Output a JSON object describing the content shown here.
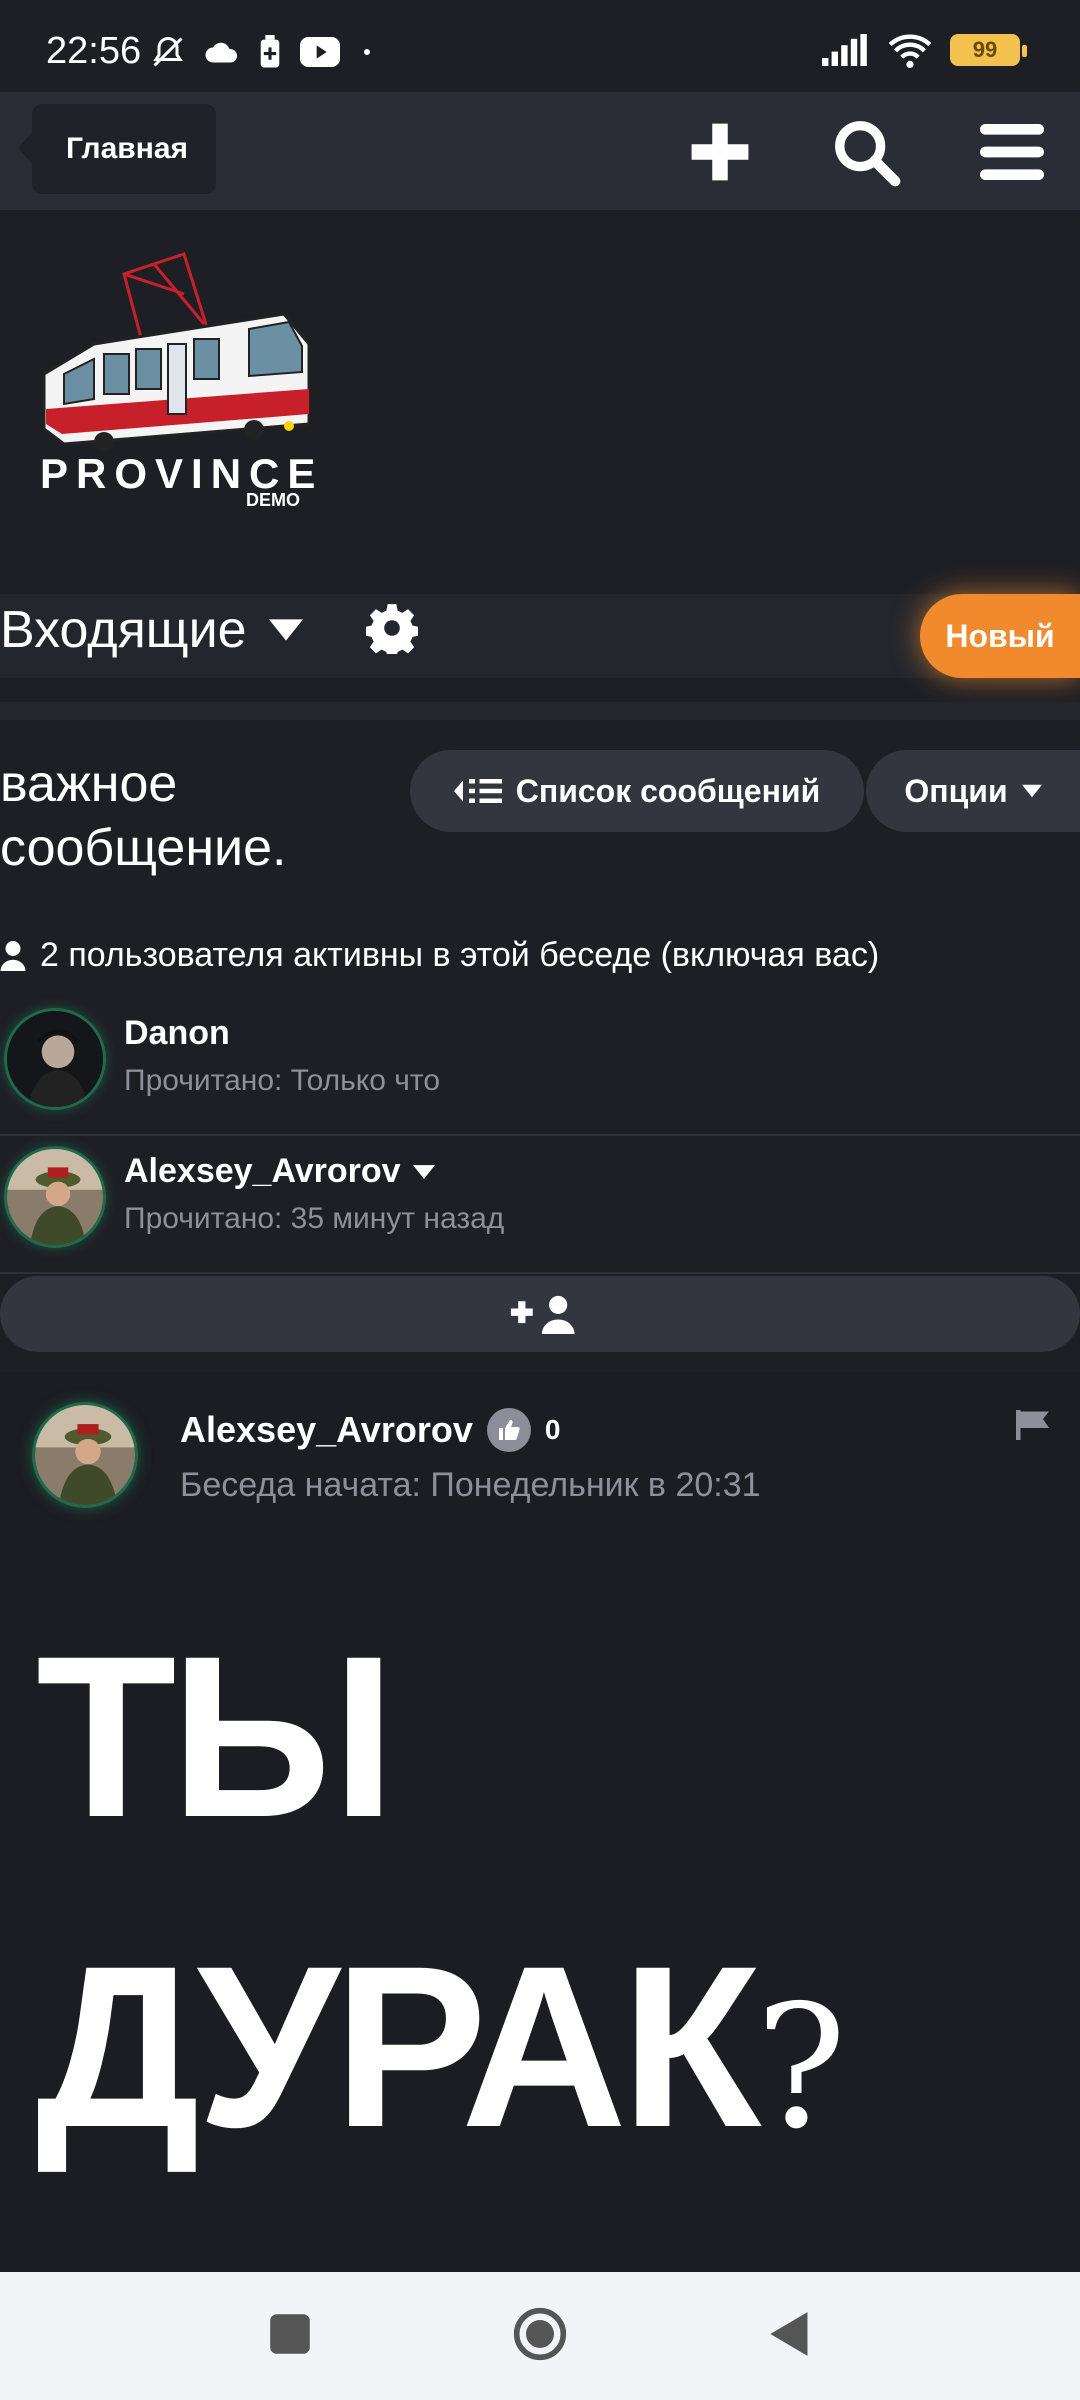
{
  "status_bar": {
    "time": "22:56",
    "battery": "99",
    "icons": [
      "mute-bell-icon",
      "cloud-icon",
      "battery-saver-icon",
      "youtube-icon",
      "dot-icon",
      "signal-icon",
      "wifi-icon",
      "battery-icon"
    ]
  },
  "navbar": {
    "home_label": "Главная",
    "icons": [
      "plus-icon",
      "search-icon",
      "menu-icon"
    ]
  },
  "logo": {
    "text": "PROVINCE",
    "subtext": "DEMO"
  },
  "inbox": {
    "title": "Входящие",
    "new_button": "Новый"
  },
  "conversation": {
    "title": "важное сообщение.",
    "message_list_button": "Список сообщений",
    "options_button": "Опции",
    "active_users_text": "2 пользователя активны в этой беседе (включая вас)",
    "participants": [
      {
        "name": "Danon",
        "read": "Прочитано: Только что"
      },
      {
        "name": "Alexsey_Avrorov",
        "read": "Прочитано: 35 минут назад"
      }
    ]
  },
  "message": {
    "author": "Alexsey_Avrorov",
    "likes": "0",
    "meta": "Беседа начата: Понедельник в 20:31",
    "line1": "ТЫ",
    "line2": "ДУРАК",
    "line2_suffix": "?"
  },
  "colors": {
    "accent": "#f08a2c",
    "background": "#1e1f25",
    "surface": "#2a2d36",
    "muted_text": "#8d909a",
    "avatar_ring": "#1e6b4c"
  }
}
